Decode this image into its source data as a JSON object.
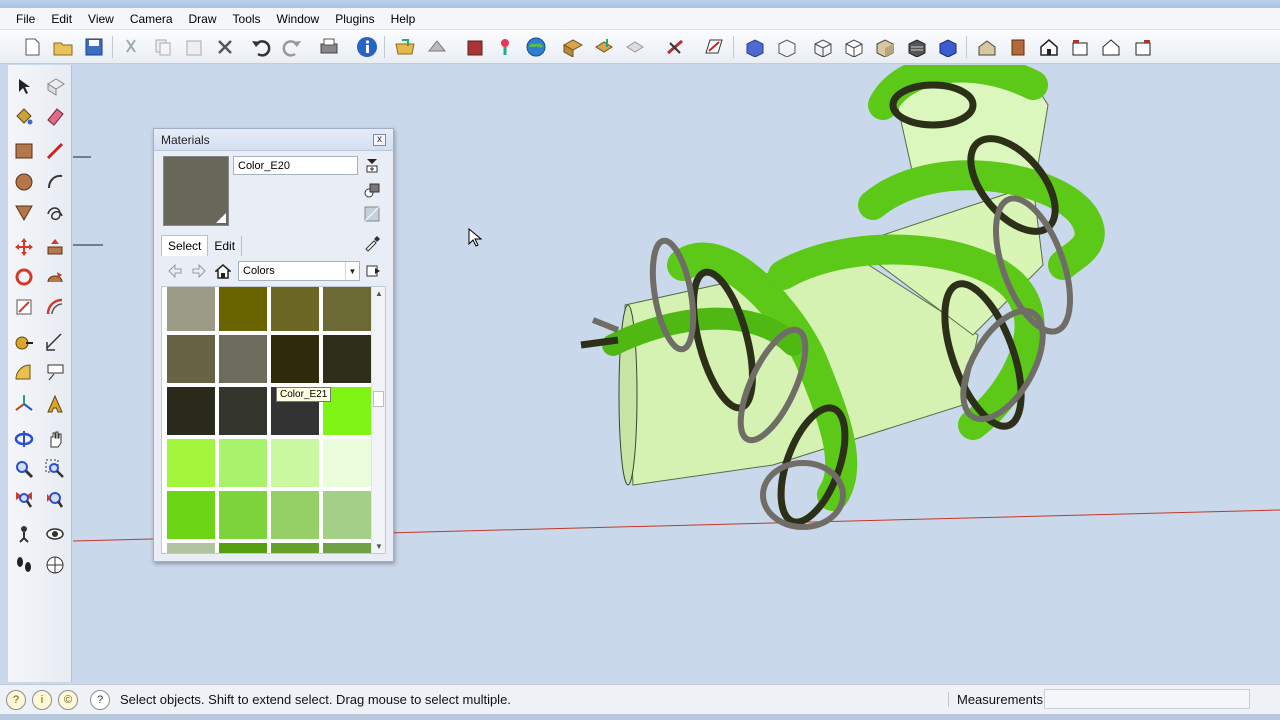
{
  "menubar": {
    "items": [
      "File",
      "Edit",
      "View",
      "Camera",
      "Draw",
      "Tools",
      "Window",
      "Plugins",
      "Help"
    ]
  },
  "materials_panel": {
    "title": "Materials",
    "close_glyph": "x",
    "material_name": "Color_E20",
    "tabs": [
      "Select",
      "Edit"
    ],
    "collection": "Colors",
    "tooltip": "Color_E21",
    "preview_color": "#67675a",
    "swatches": [
      [
        "#9b9b86",
        "#696300",
        "#6b6823",
        "#6b6a35"
      ],
      [
        "#676445",
        "#6c6c5f",
        "#2f2a0a",
        "#2e2f1b"
      ],
      [
        "#2a2a1c",
        "#34352c",
        "#333333",
        "#7ff516"
      ],
      [
        "#a2f53b",
        "#a8f36b",
        "#c9f8a1",
        "#eafcd9"
      ],
      [
        "#6cd515",
        "#7cd33a",
        "#94d065",
        "#a4cf86"
      ],
      [
        "#b1c3a0",
        "#55a00f",
        "#66a229",
        "#6fa246"
      ]
    ]
  },
  "status": {
    "message": "Select objects. Shift to extend select. Drag mouse to select multiple.",
    "measurements_label": "Measurements",
    "measurements_value": ""
  },
  "colors": {
    "viewport_bg": "#c9d8ea",
    "axis_red": "#c0392b",
    "tube_green": "#5cc817",
    "cylinder_light": "#d9f5b6"
  }
}
